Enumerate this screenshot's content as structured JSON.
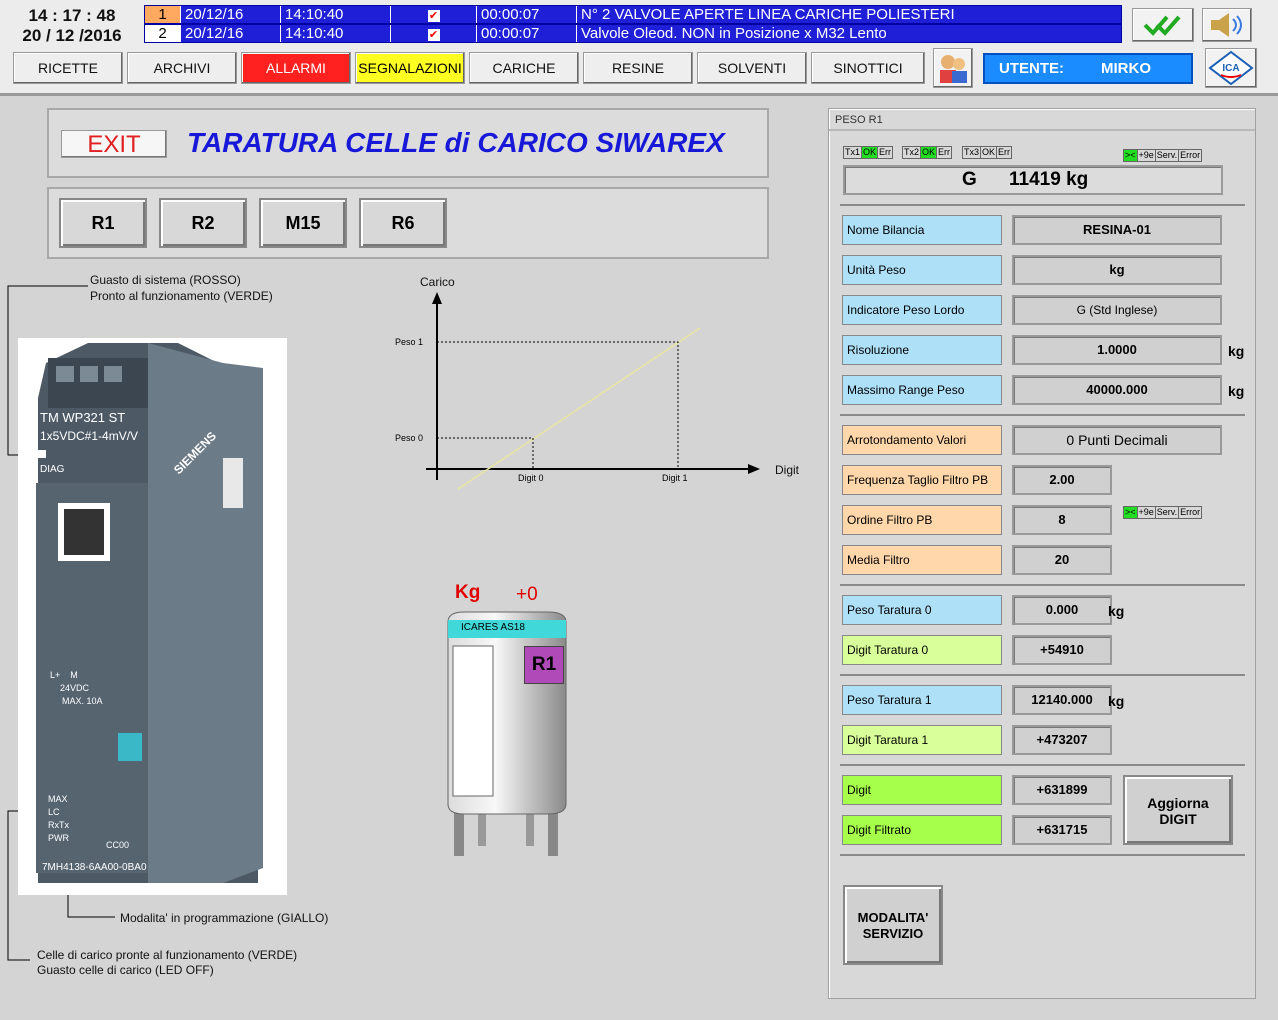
{
  "header": {
    "time": "14 : 17 : 48",
    "date": "20 / 12 /2016",
    "alarms": [
      {
        "num": "1",
        "date": "20/12/16",
        "time": "14:10:40",
        "duration": "00:00:07",
        "message": "N° 2 VALVOLE APERTE LINEA CARICHE POLIESTERI"
      },
      {
        "num": "2",
        "date": "20/12/16",
        "time": "14:10:40",
        "duration": "00:00:07",
        "message": "Valvole Oleod. NON in Posizione x M32 Lento"
      }
    ]
  },
  "nav": [
    "RICETTE",
    "ARCHIVI",
    "ALLARMI",
    "SEGNALAZIONI",
    "CARICHE",
    "RESINE",
    "SOLVENTI",
    "SINOTTICI"
  ],
  "user": {
    "label": "UTENTE:",
    "name": "MIRKO"
  },
  "title": {
    "exit": "EXIT",
    "text": "TARATURA CELLE di CARICO SIWAREX"
  },
  "scales": [
    "R1",
    "R2",
    "M15",
    "R6"
  ],
  "notes": {
    "top1": "Guasto di sistema (ROSSO)",
    "top2": "Pronto al funzionamento  (VERDE)",
    "mid": "Modalita' in programmazione  (GIALLO)",
    "bot1": "Celle di carico pronte al funzionamento (VERDE)",
    "bot2": "Guasto celle di carico (LED OFF)"
  },
  "module": {
    "brand": "SIEMENS",
    "model": "TM WP321    ST",
    "spec": "1x5VDC#1-4mV/V",
    "diag": "DIAG",
    "part": "7MH4138-6AA00-0BA0",
    "code": "CC00",
    "max": "MAX. 10A",
    "supply": "24VDC",
    "pins": "L+    M",
    "lights": [
      "MAX",
      "LC",
      "RxTx",
      "PWR"
    ]
  },
  "graph": {
    "ylabel": "Carico",
    "xlabel": "Digit",
    "y1": "Peso 1",
    "y0": "Peso 0",
    "x0": "Digit 0",
    "x1": "Digit 1"
  },
  "tank": {
    "unit": "Kg",
    "value": "+0",
    "brand": "ICARES AS18",
    "id": "R1"
  },
  "right": {
    "title": "PESO R1",
    "tx": [
      "Tx1",
      "OK",
      "Err",
      "Tx2",
      "OK",
      "Err",
      "Tx3",
      "OK",
      "Err"
    ],
    "status": [
      ">< ",
      "+9e",
      "Serv.",
      "Error"
    ],
    "gross_label": "G",
    "gross_value": "11419 kg",
    "rows": [
      {
        "label": "Nome Bilancia",
        "value": "RESINA-01",
        "unit": ""
      },
      {
        "label": "Unità Peso",
        "value": "kg",
        "unit": ""
      },
      {
        "label": "Indicatore Peso Lordo",
        "value": "G  (Std Inglese)",
        "unit": ""
      },
      {
        "label": "Risoluzione",
        "value": "1.0000",
        "unit": "kg"
      },
      {
        "label": "Massimo Range Peso",
        "value": "40000.000",
        "unit": "kg"
      },
      {
        "label": "Arrotondamento Valori",
        "value": "0 Punti Decimali",
        "unit": ""
      },
      {
        "label": "Frequenza Taglio Filtro PB",
        "value": "2.00",
        "unit": ""
      },
      {
        "label": "Ordine Filtro PB",
        "value": "8",
        "unit": ""
      },
      {
        "label": "Media Filtro",
        "value": "20",
        "unit": ""
      },
      {
        "label": "Peso Taratura 0",
        "value": "0.000",
        "unit": "kg"
      },
      {
        "label": "Digit  Taratura 0",
        "value": "+54910",
        "unit": ""
      },
      {
        "label": "Peso Taratura 1",
        "value": "12140.000",
        "unit": "kg"
      },
      {
        "label": "Digit  Taratura 1",
        "value": "+473207",
        "unit": ""
      },
      {
        "label": "Digit",
        "value": "+631899",
        "unit": ""
      },
      {
        "label": "Digit Filtrato",
        "value": "+631715",
        "unit": ""
      }
    ],
    "update": "Aggiorna DIGIT",
    "service": "MODALITA' SERVIZIO"
  }
}
